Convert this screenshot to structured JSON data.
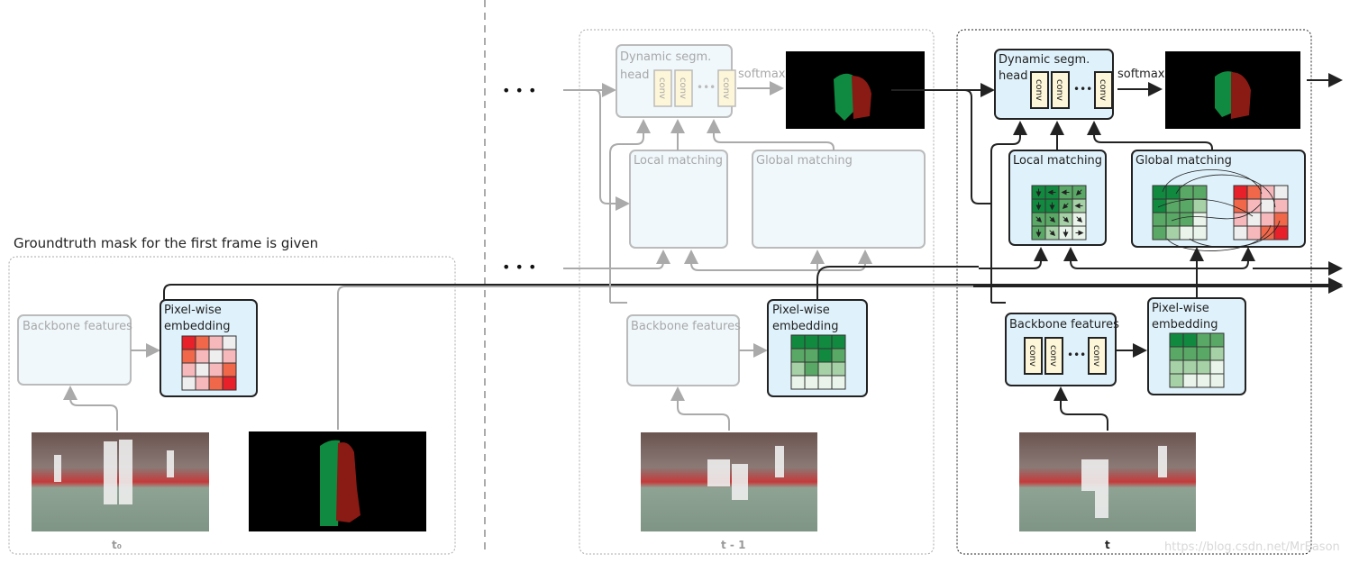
{
  "title": "Groundtruth mask for the first frame is given",
  "ellipsis": "• • •",
  "frames": [
    {
      "label": "t₀",
      "backbone": "Backbone features",
      "embedding": [
        "Pixel-wise",
        "embedding"
      ]
    },
    {
      "label": "t - 1",
      "backbone": "Backbone features",
      "embedding": [
        "Pixel-wise",
        "embedding"
      ],
      "head": [
        "Dynamic segm.",
        "head"
      ],
      "softmax": "softmax",
      "local": "Local matching",
      "global": "Global matching",
      "conv": "conv"
    },
    {
      "label": "t",
      "backbone": "Backbone features",
      "embedding": [
        "Pixel-wise",
        "embedding"
      ],
      "head": [
        "Dynamic segm.",
        "head"
      ],
      "softmax": "softmax",
      "local": "Local matching",
      "global": "Global matching",
      "conv": "conv"
    }
  ],
  "watermark": "https://blog.csdn.net/MrEason",
  "colors": {
    "box_fill": "#dff1fa",
    "conv_fill": "#fdf6d8",
    "green": "#1a8a42",
    "red": "#e8202a",
    "mask_green": "#0f8a40",
    "mask_red": "#8a1a14"
  }
}
